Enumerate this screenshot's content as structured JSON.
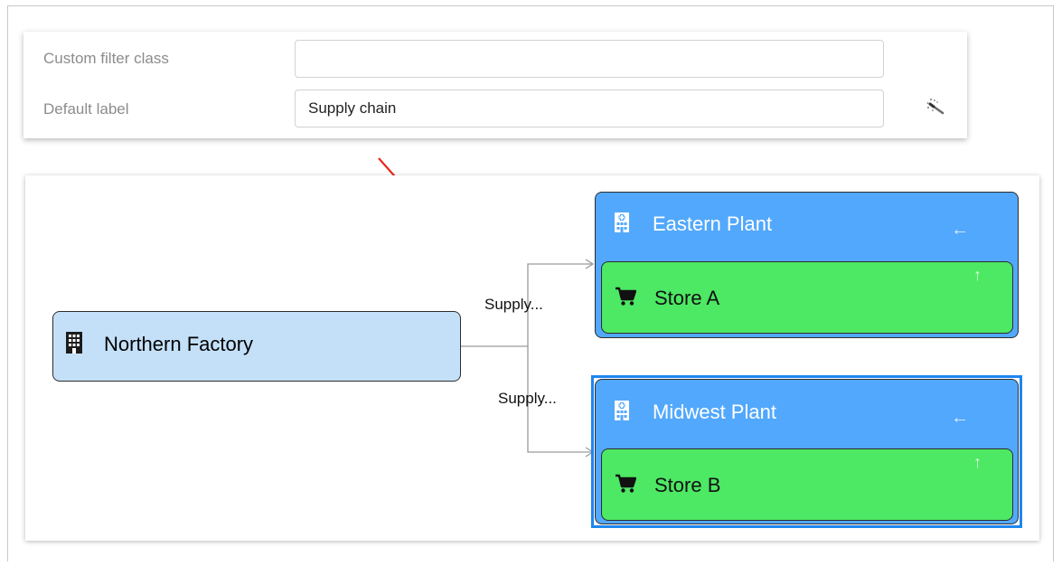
{
  "form": {
    "fields": [
      {
        "label": "Custom filter class",
        "value": "",
        "placeholder": ""
      },
      {
        "label": "Default label",
        "value": "Supply chain",
        "placeholder": ""
      }
    ],
    "action_icon": "magic-wand-icon"
  },
  "diagram": {
    "source": {
      "title": "Northern Factory",
      "icon": "office-building-icon"
    },
    "edges": [
      {
        "label": "Supply..."
      },
      {
        "label": "Supply..."
      }
    ],
    "plants": [
      {
        "title": "Eastern Plant",
        "icon": "hospital-building-icon",
        "collapse_glyph": "←",
        "selected": false,
        "store": {
          "title": "Store A",
          "icon": "cart-icon",
          "expand_glyph": "↑"
        }
      },
      {
        "title": "Midwest Plant",
        "icon": "hospital-building-icon",
        "collapse_glyph": "←",
        "selected": true,
        "store": {
          "title": "Store B",
          "icon": "cart-icon",
          "expand_glyph": "↑"
        }
      }
    ]
  },
  "colors": {
    "source_fill": "#c4e0f9",
    "plant_fill": "#52a8fc",
    "store_fill": "#4de864",
    "selection": "#1e86f0",
    "annotation_arrow": "#e8281e",
    "edge": "#9a9a9a"
  }
}
